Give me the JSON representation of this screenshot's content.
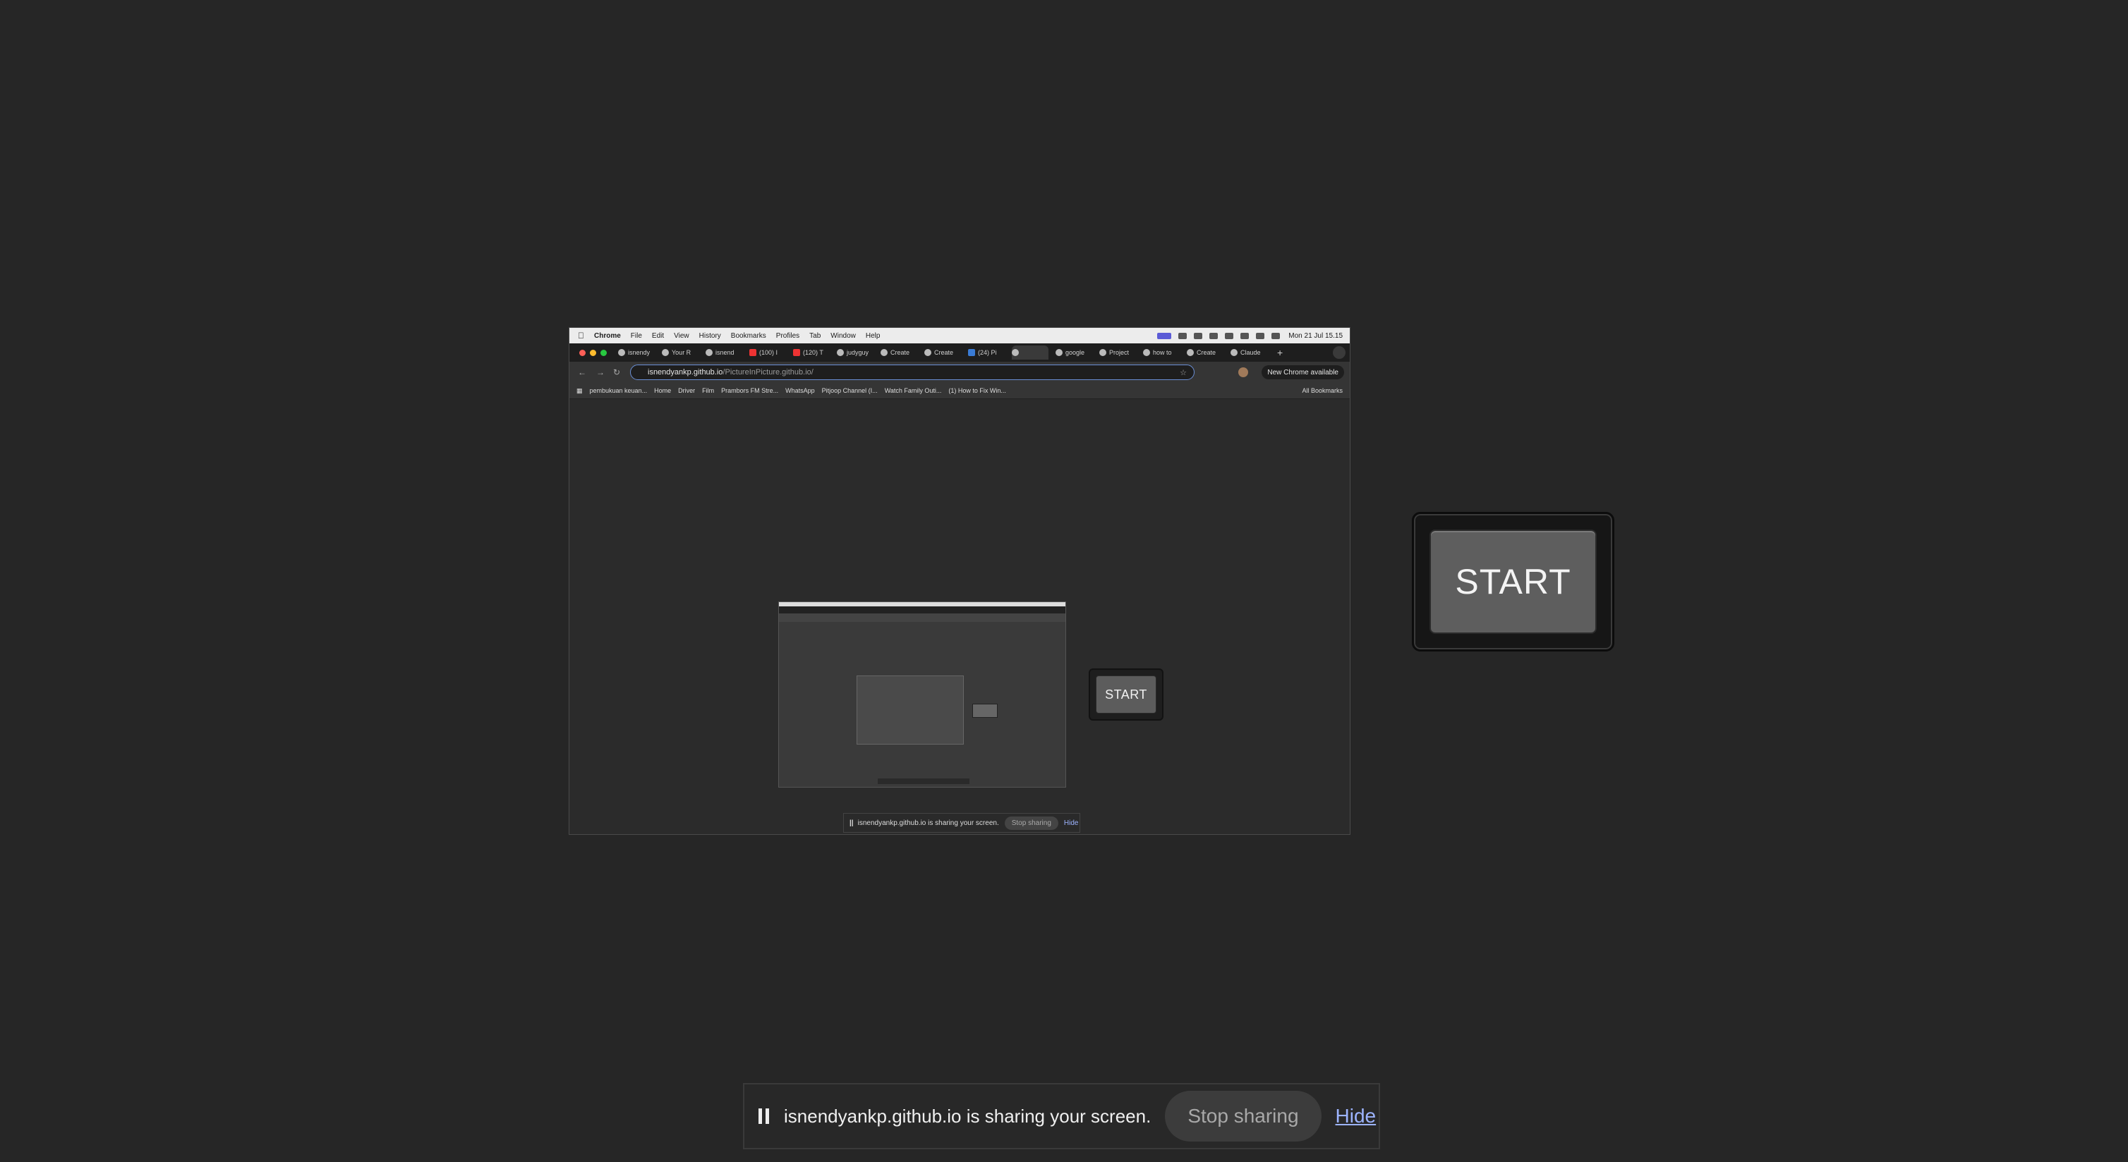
{
  "inner_window": {
    "menubar": {
      "items": [
        "Chrome",
        "File",
        "Edit",
        "View",
        "History",
        "Bookmarks",
        "Profiles",
        "Tab",
        "Window",
        "Help"
      ],
      "clock": "Mon 21 Jul  15.15"
    },
    "tabs": [
      {
        "label": "isnendy",
        "icon": "github-icon"
      },
      {
        "label": "Your R",
        "icon": "github-icon"
      },
      {
        "label": "isnend",
        "icon": "github-icon"
      },
      {
        "label": "(100) I",
        "icon": "youtube-icon"
      },
      {
        "label": "(120) T",
        "icon": "youtube-icon"
      },
      {
        "label": "judyguy",
        "icon": "github-icon"
      },
      {
        "label": "Create",
        "icon": "drive-icon"
      },
      {
        "label": "Create",
        "icon": "github-icon"
      },
      {
        "label": "(24) Pi",
        "icon": "linkedin-icon"
      },
      {
        "label": "",
        "icon": "active-tab-icon"
      },
      {
        "label": "google",
        "icon": "github-icon"
      },
      {
        "label": "Project",
        "icon": "project-icon"
      },
      {
        "label": "how to",
        "icon": "notion-icon"
      },
      {
        "label": "Create",
        "icon": "github-icon"
      },
      {
        "label": "Claude",
        "icon": "claude-icon"
      }
    ],
    "address": {
      "domain": "isnendyankp.github.io",
      "path": "/PictureInPicture.github.io/"
    },
    "update_button": "New Chrome available",
    "bookmarks": [
      "pembukuan keuan...",
      "Home",
      "Driver",
      "Film",
      "Prambors FM Stre...",
      "WhatsApp",
      "Pitjoop Channel (I...",
      "Watch Family Outi...",
      "(1) How to Fix Win..."
    ],
    "all_bookmarks": "All Bookmarks",
    "start_label": "START",
    "share_bar": {
      "message": "isnendyankp.github.io is sharing your screen.",
      "stop": "Stop sharing",
      "hide": "Hide"
    }
  },
  "start_button": {
    "label": "START"
  },
  "share_bar": {
    "message": "isnendyankp.github.io is sharing your screen.",
    "stop": "Stop sharing",
    "hide": "Hide"
  },
  "colors": {
    "background": "#262626",
    "button_face": "#5e5e5e",
    "link": "#9db4ff"
  }
}
